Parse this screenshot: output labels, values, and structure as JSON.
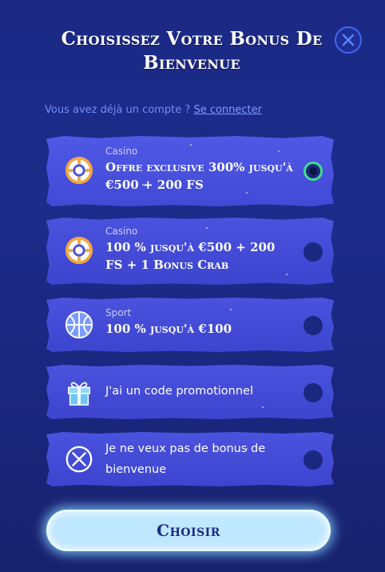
{
  "header": {
    "title": "Choisissez Votre Bonus De Bienvenue"
  },
  "login": {
    "prompt": "Vous avez déjà un compte ?",
    "link": "Se connecter"
  },
  "options": [
    {
      "category": "Casino",
      "title": "Offre exclusive 300% jusqu'à €500 + 200 FS",
      "icon": "casino-chip-icon",
      "selected": true
    },
    {
      "category": "Casino",
      "title": "100 % jusqu'à €500 + 200 FS + 1 Bonus Crab",
      "icon": "casino-chip-icon",
      "selected": false
    },
    {
      "category": "Sport",
      "title": "100 % jusqu'à €100",
      "icon": "basketball-icon",
      "selected": false
    },
    {
      "title": "J'ai un code promotionnel",
      "icon": "gift-icon",
      "selected": false
    },
    {
      "title": "Je ne veux pas de bonus de bienvenue",
      "icon": "no-bonus-icon",
      "selected": false
    }
  ],
  "action": {
    "label": "Choisir"
  },
  "colors": {
    "accent": "#3ee088",
    "card": "#4a52de",
    "background": "#1c2a86",
    "link": "#7c9bff"
  }
}
